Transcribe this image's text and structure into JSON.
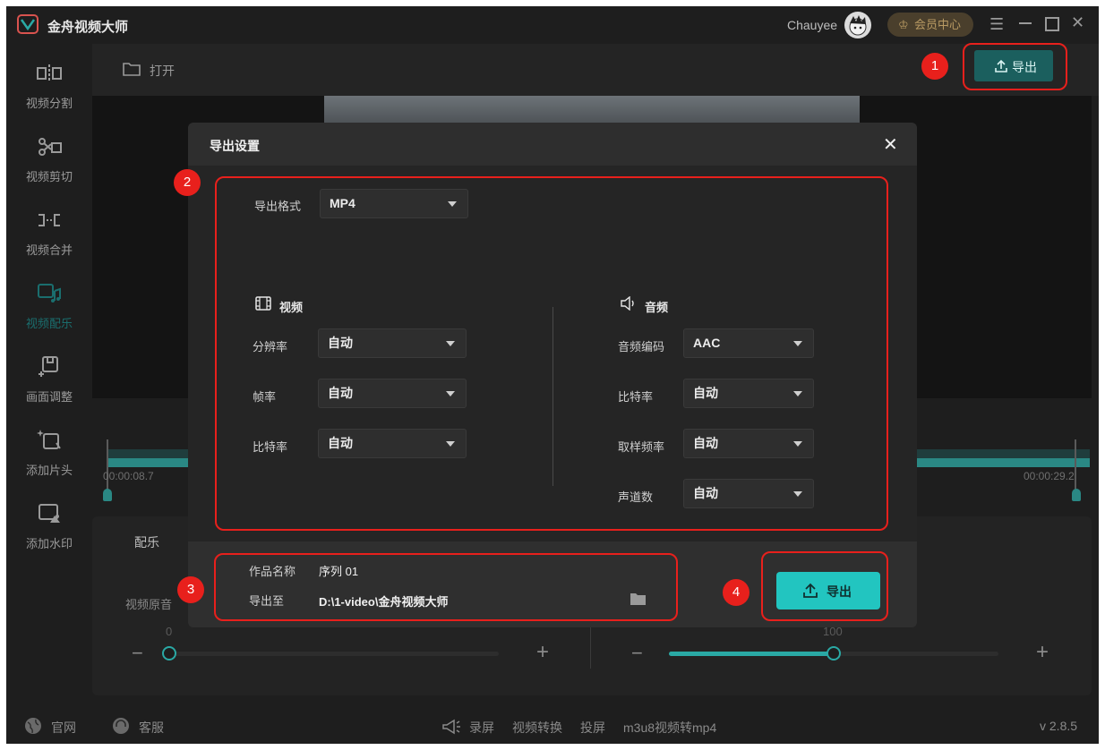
{
  "app": {
    "title": "金舟视频大师",
    "user_name": "Chauyee",
    "member_label": "会员中心",
    "version": "v 2.8.5"
  },
  "sidebar": {
    "items": [
      {
        "label": "视频分割",
        "icon": "split-icon"
      },
      {
        "label": "视频剪切",
        "icon": "scissors-icon"
      },
      {
        "label": "视频合并",
        "icon": "merge-icon"
      },
      {
        "label": "视频配乐",
        "icon": "music-icon",
        "active": true
      },
      {
        "label": "画面调整",
        "icon": "crop-icon"
      },
      {
        "label": "添加片头",
        "icon": "intro-icon"
      },
      {
        "label": "添加水印",
        "icon": "watermark-icon"
      }
    ]
  },
  "toolbar": {
    "open_label": "打开",
    "export_label": "导出"
  },
  "timeline": {
    "start_time": "00:00:08.7",
    "end_time": "00:00:29.2"
  },
  "audio_panel": {
    "tab_label": "配乐",
    "original_label": "视频原音",
    "left_value": "0",
    "right_value": "100"
  },
  "dialog": {
    "title": "导出设置",
    "format_label": "导出格式",
    "format_value": "MP4",
    "video_section": "视频",
    "audio_section": "音频",
    "video_fields": [
      {
        "label": "分辨率",
        "value": "自动"
      },
      {
        "label": "帧率",
        "value": "自动"
      },
      {
        "label": "比特率",
        "value": "自动"
      }
    ],
    "audio_fields": [
      {
        "label": "音频编码",
        "value": "AAC"
      },
      {
        "label": "比特率",
        "value": "自动"
      },
      {
        "label": "取样频率",
        "value": "自动"
      },
      {
        "label": "声道数",
        "value": "自动"
      }
    ],
    "name_label": "作品名称",
    "name_value": "序列 01",
    "path_label": "导出至",
    "path_value": "D:\\1-video\\金舟视频大师",
    "export_label": "导出"
  },
  "annotations": {
    "badges": [
      "1",
      "2",
      "3",
      "4"
    ],
    "color": "#e8201c"
  },
  "bottom_bar": {
    "website": "官网",
    "service": "客服",
    "record": "录屏",
    "convert": "视频转换",
    "cast": "投屏",
    "m3u8": "m3u8视频转mp4"
  },
  "colors": {
    "accent": "#22c5c0",
    "accent_dark": "#1b5f5e",
    "background": "#1e1e1e"
  }
}
